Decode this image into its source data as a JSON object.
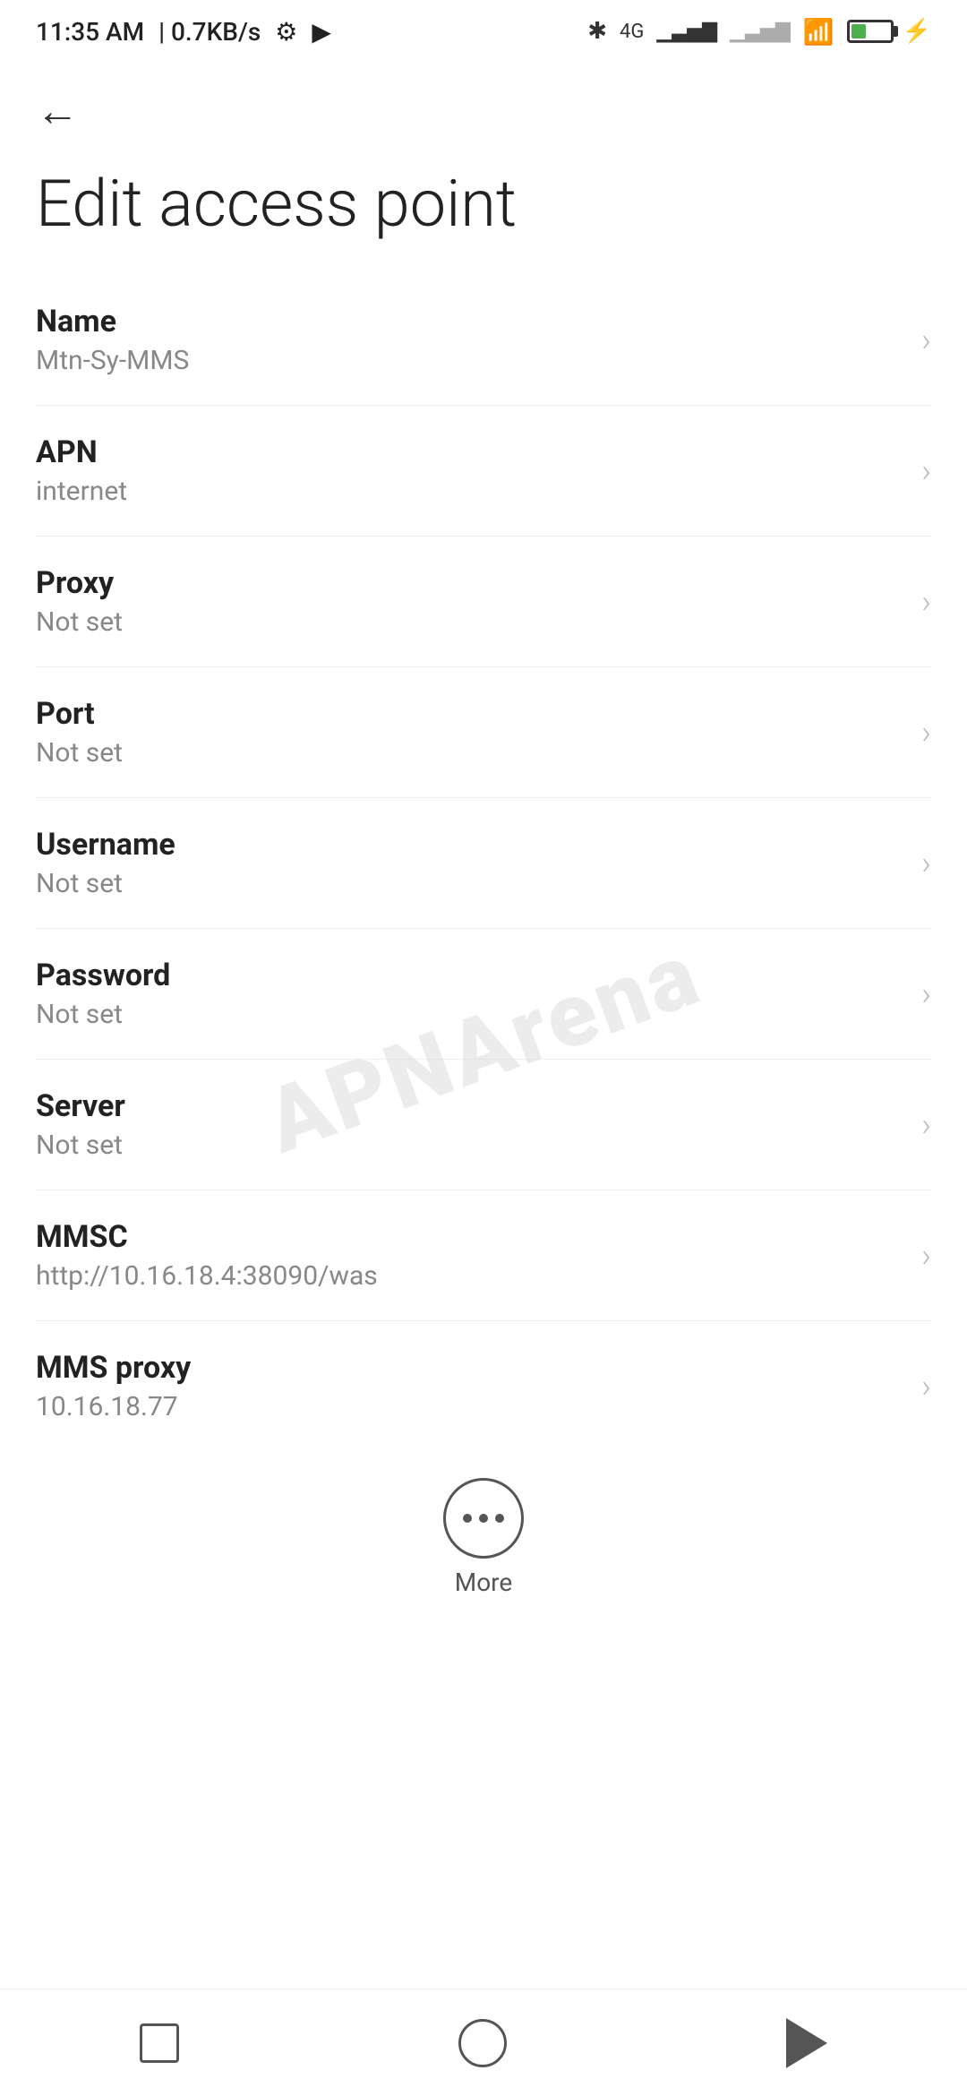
{
  "statusBar": {
    "time": "11:35 AM",
    "speed": "0.7KB/s",
    "battery": 38
  },
  "header": {
    "backLabel": "←",
    "title": "Edit access point"
  },
  "settings": [
    {
      "id": "name",
      "label": "Name",
      "value": "Mtn-Sy-MMS"
    },
    {
      "id": "apn",
      "label": "APN",
      "value": "internet"
    },
    {
      "id": "proxy",
      "label": "Proxy",
      "value": "Not set"
    },
    {
      "id": "port",
      "label": "Port",
      "value": "Not set"
    },
    {
      "id": "username",
      "label": "Username",
      "value": "Not set"
    },
    {
      "id": "password",
      "label": "Password",
      "value": "Not set"
    },
    {
      "id": "server",
      "label": "Server",
      "value": "Not set"
    },
    {
      "id": "mmsc",
      "label": "MMSC",
      "value": "http://10.16.18.4:38090/was"
    },
    {
      "id": "mms-proxy",
      "label": "MMS proxy",
      "value": "10.16.18.77"
    }
  ],
  "watermark": "APNArena",
  "more": {
    "label": "More"
  },
  "nav": {
    "square": "recent-apps",
    "circle": "home",
    "triangle": "back"
  }
}
